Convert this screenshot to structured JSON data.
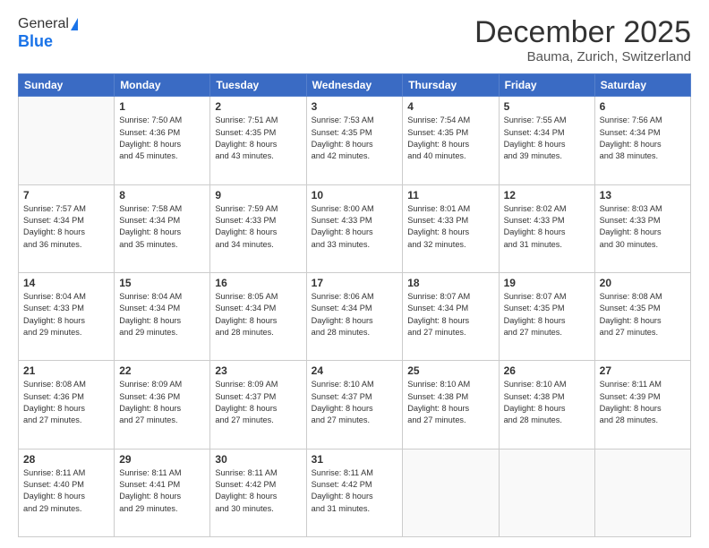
{
  "header": {
    "logo_general": "General",
    "logo_blue": "Blue",
    "month_title": "December 2025",
    "location": "Bauma, Zurich, Switzerland"
  },
  "days_of_week": [
    "Sunday",
    "Monday",
    "Tuesday",
    "Wednesday",
    "Thursday",
    "Friday",
    "Saturday"
  ],
  "weeks": [
    [
      {
        "day": "",
        "content": ""
      },
      {
        "day": "1",
        "content": "Sunrise: 7:50 AM\nSunset: 4:36 PM\nDaylight: 8 hours\nand 45 minutes."
      },
      {
        "day": "2",
        "content": "Sunrise: 7:51 AM\nSunset: 4:35 PM\nDaylight: 8 hours\nand 43 minutes."
      },
      {
        "day": "3",
        "content": "Sunrise: 7:53 AM\nSunset: 4:35 PM\nDaylight: 8 hours\nand 42 minutes."
      },
      {
        "day": "4",
        "content": "Sunrise: 7:54 AM\nSunset: 4:35 PM\nDaylight: 8 hours\nand 40 minutes."
      },
      {
        "day": "5",
        "content": "Sunrise: 7:55 AM\nSunset: 4:34 PM\nDaylight: 8 hours\nand 39 minutes."
      },
      {
        "day": "6",
        "content": "Sunrise: 7:56 AM\nSunset: 4:34 PM\nDaylight: 8 hours\nand 38 minutes."
      }
    ],
    [
      {
        "day": "7",
        "content": "Sunrise: 7:57 AM\nSunset: 4:34 PM\nDaylight: 8 hours\nand 36 minutes."
      },
      {
        "day": "8",
        "content": "Sunrise: 7:58 AM\nSunset: 4:34 PM\nDaylight: 8 hours\nand 35 minutes."
      },
      {
        "day": "9",
        "content": "Sunrise: 7:59 AM\nSunset: 4:33 PM\nDaylight: 8 hours\nand 34 minutes."
      },
      {
        "day": "10",
        "content": "Sunrise: 8:00 AM\nSunset: 4:33 PM\nDaylight: 8 hours\nand 33 minutes."
      },
      {
        "day": "11",
        "content": "Sunrise: 8:01 AM\nSunset: 4:33 PM\nDaylight: 8 hours\nand 32 minutes."
      },
      {
        "day": "12",
        "content": "Sunrise: 8:02 AM\nSunset: 4:33 PM\nDaylight: 8 hours\nand 31 minutes."
      },
      {
        "day": "13",
        "content": "Sunrise: 8:03 AM\nSunset: 4:33 PM\nDaylight: 8 hours\nand 30 minutes."
      }
    ],
    [
      {
        "day": "14",
        "content": "Sunrise: 8:04 AM\nSunset: 4:33 PM\nDaylight: 8 hours\nand 29 minutes."
      },
      {
        "day": "15",
        "content": "Sunrise: 8:04 AM\nSunset: 4:34 PM\nDaylight: 8 hours\nand 29 minutes."
      },
      {
        "day": "16",
        "content": "Sunrise: 8:05 AM\nSunset: 4:34 PM\nDaylight: 8 hours\nand 28 minutes."
      },
      {
        "day": "17",
        "content": "Sunrise: 8:06 AM\nSunset: 4:34 PM\nDaylight: 8 hours\nand 28 minutes."
      },
      {
        "day": "18",
        "content": "Sunrise: 8:07 AM\nSunset: 4:34 PM\nDaylight: 8 hours\nand 27 minutes."
      },
      {
        "day": "19",
        "content": "Sunrise: 8:07 AM\nSunset: 4:35 PM\nDaylight: 8 hours\nand 27 minutes."
      },
      {
        "day": "20",
        "content": "Sunrise: 8:08 AM\nSunset: 4:35 PM\nDaylight: 8 hours\nand 27 minutes."
      }
    ],
    [
      {
        "day": "21",
        "content": "Sunrise: 8:08 AM\nSunset: 4:36 PM\nDaylight: 8 hours\nand 27 minutes."
      },
      {
        "day": "22",
        "content": "Sunrise: 8:09 AM\nSunset: 4:36 PM\nDaylight: 8 hours\nand 27 minutes."
      },
      {
        "day": "23",
        "content": "Sunrise: 8:09 AM\nSunset: 4:37 PM\nDaylight: 8 hours\nand 27 minutes."
      },
      {
        "day": "24",
        "content": "Sunrise: 8:10 AM\nSunset: 4:37 PM\nDaylight: 8 hours\nand 27 minutes."
      },
      {
        "day": "25",
        "content": "Sunrise: 8:10 AM\nSunset: 4:38 PM\nDaylight: 8 hours\nand 27 minutes."
      },
      {
        "day": "26",
        "content": "Sunrise: 8:10 AM\nSunset: 4:38 PM\nDaylight: 8 hours\nand 28 minutes."
      },
      {
        "day": "27",
        "content": "Sunrise: 8:11 AM\nSunset: 4:39 PM\nDaylight: 8 hours\nand 28 minutes."
      }
    ],
    [
      {
        "day": "28",
        "content": "Sunrise: 8:11 AM\nSunset: 4:40 PM\nDaylight: 8 hours\nand 29 minutes."
      },
      {
        "day": "29",
        "content": "Sunrise: 8:11 AM\nSunset: 4:41 PM\nDaylight: 8 hours\nand 29 minutes."
      },
      {
        "day": "30",
        "content": "Sunrise: 8:11 AM\nSunset: 4:42 PM\nDaylight: 8 hours\nand 30 minutes."
      },
      {
        "day": "31",
        "content": "Sunrise: 8:11 AM\nSunset: 4:42 PM\nDaylight: 8 hours\nand 31 minutes."
      },
      {
        "day": "",
        "content": ""
      },
      {
        "day": "",
        "content": ""
      },
      {
        "day": "",
        "content": ""
      }
    ]
  ]
}
